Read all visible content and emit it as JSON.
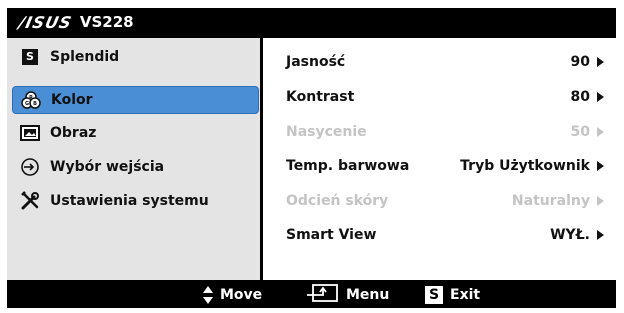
{
  "header": {
    "brand": "/ISUS",
    "model": "VS228"
  },
  "menu": [
    {
      "label": "Splendid",
      "icon": "s-box-icon"
    },
    {
      "label": "Kolor",
      "icon": "color-wheel-icon"
    },
    {
      "label": "Obraz",
      "icon": "image-icon"
    },
    {
      "label": "Wybór wejścia",
      "icon": "input-icon"
    },
    {
      "label": "Ustawienia systemu",
      "icon": "tools-icon"
    }
  ],
  "selected_menu": "Kolor",
  "settings": [
    {
      "label": "Jasność",
      "value": "90",
      "enabled": true
    },
    {
      "label": "Kontrast",
      "value": "80",
      "enabled": true
    },
    {
      "label": "Nasycenie",
      "value": "50",
      "enabled": false
    },
    {
      "label": "Temp. barwowa",
      "value": "Tryb Użytkownik",
      "enabled": true
    },
    {
      "label": "Odcień skóry",
      "value": "Naturalny",
      "enabled": false
    },
    {
      "label": "Smart View",
      "value": "WYŁ.",
      "enabled": true
    }
  ],
  "footer": {
    "move": "Move",
    "menu": "Menu",
    "exit_key": "S",
    "exit": "Exit"
  },
  "colors": {
    "selected": "#4a8fd6",
    "disabled_text": "#c4c4c4",
    "sidebar_bg": "#e4e4e4"
  }
}
